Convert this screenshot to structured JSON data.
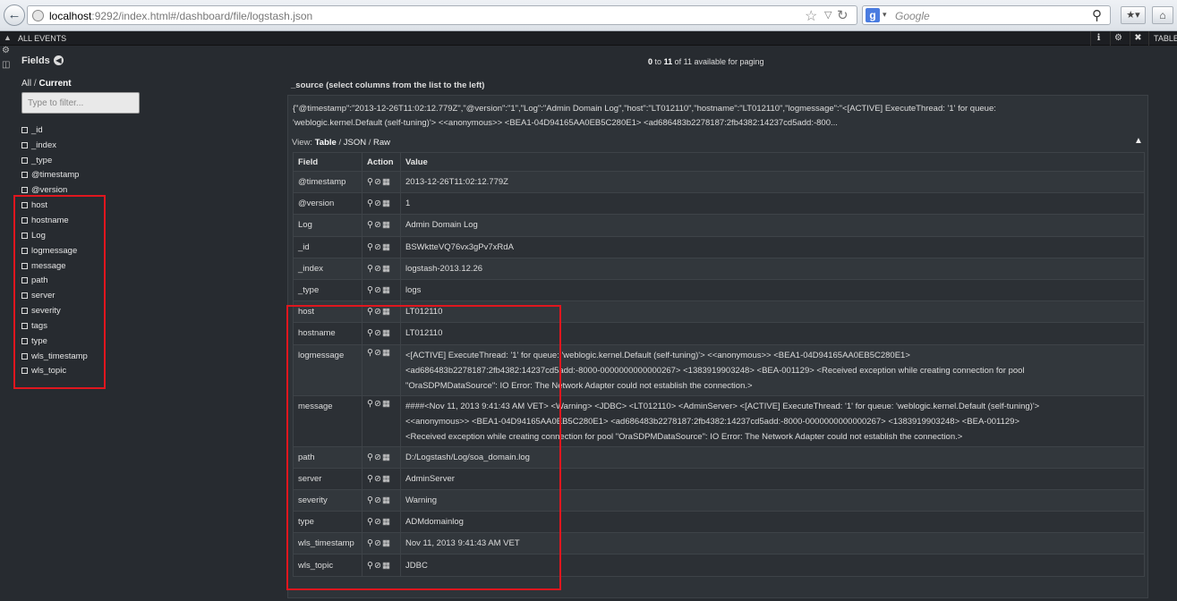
{
  "browser": {
    "url_host": "localhost",
    "url_rest": ":9292/index.html#/dashboard/file/logstash.json",
    "search_engine": "g",
    "search_placeholder": "Google",
    "back_glyph": "←"
  },
  "topbar": {
    "title": "ALL EVENTS",
    "table_label": "TABLE"
  },
  "fields": {
    "title": "Fields",
    "all_label": "All",
    "separator": "/",
    "current_label": "Current",
    "filter_placeholder": "Type to filter...",
    "items": [
      "_id",
      "_index",
      "_type",
      "@timestamp",
      "@version",
      "host",
      "hostname",
      "Log",
      "logmessage",
      "message",
      "path",
      "server",
      "severity",
      "tags",
      "type",
      "wls_timestamp",
      "wls_topic"
    ]
  },
  "paging": {
    "from": "0",
    "to_word": "to",
    "to": "11",
    "total_text": "of 11 available for paging"
  },
  "document": {
    "source_header": "_source (select columns from the list to the left)",
    "source_line1": "{\"@timestamp\":\"2013-12-26T11:02:12.779Z\",\"@version\":\"1\",\"Log\":\"Admin Domain Log\",\"host\":\"LT012110\",\"hostname\":\"LT012110\",\"logmessage\":\"<[ACTIVE] ExecuteThread: '1' for queue:",
    "source_line2": "'weblogic.kernel.Default (self-tuning)'> <<anonymous>> <BEA1-04D94165AA0EB5C280E1> <ad686483b2278187:2fb4382:14237cd5add:-800...",
    "view_label": "View:",
    "view_table": "Table",
    "view_json": "JSON",
    "view_raw": "Raw",
    "columns": {
      "field": "Field",
      "action": "Action",
      "value": "Value"
    },
    "rows": [
      {
        "field": "@timestamp",
        "value": "2013-12-26T11:02:12.779Z"
      },
      {
        "field": "@version",
        "value": "1"
      },
      {
        "field": "Log",
        "value": "Admin Domain Log"
      },
      {
        "field": "_id",
        "value": "BSWktteVQ76vx3gPv7xRdA"
      },
      {
        "field": "_index",
        "value": "logstash-2013.12.26"
      },
      {
        "field": "_type",
        "value": "logs"
      },
      {
        "field": "host",
        "value": "LT012110"
      },
      {
        "field": "hostname",
        "value": "LT012110"
      },
      {
        "field": "logmessage",
        "value1": "<[ACTIVE] ExecuteThread: '1' for queue: 'weblogic.kernel.Default (self-tuning)'> <<anonymous>> <BEA1-04D94165AA0EB5C280E1>",
        "value2": "<ad686483b2278187:2fb4382:14237cd5add:-8000-0000000000000267> <1383919903248> <BEA-001129> <Received exception while creating connection for pool",
        "value3": "\"OraSDPMDataSource\": IO Error: The Network Adapter could not establish the connection.>"
      },
      {
        "field": "message",
        "value1": "####<Nov 11, 2013 9:41:43 AM VET> <Warning> <JDBC> <LT012110> <AdminServer> <[ACTIVE] ExecuteThread: '1' for queue: 'weblogic.kernel.Default (self-tuning)'>",
        "value2": "<<anonymous>> <BEA1-04D94165AA0EB5C280E1> <ad686483b2278187:2fb4382:14237cd5add:-8000-0000000000000267> <1383919903248> <BEA-001129>",
        "value3": "<Received exception while creating connection for pool \"OraSDPMDataSource\": IO Error: The Network Adapter could not establish the connection.>"
      },
      {
        "field": "path",
        "value": "D:/Logstash/Log/soa_domain.log"
      },
      {
        "field": "server",
        "value": "AdminServer"
      },
      {
        "field": "severity",
        "value": "Warning"
      },
      {
        "field": "type",
        "value": "ADMdomainlog"
      },
      {
        "field": "wls_timestamp",
        "value": "Nov 11, 2013 9:41:43 AM VET"
      },
      {
        "field": "wls_topic",
        "value": "JDBC"
      }
    ]
  },
  "colors": {
    "background": "#272b30",
    "highlight": "#e0161e"
  }
}
